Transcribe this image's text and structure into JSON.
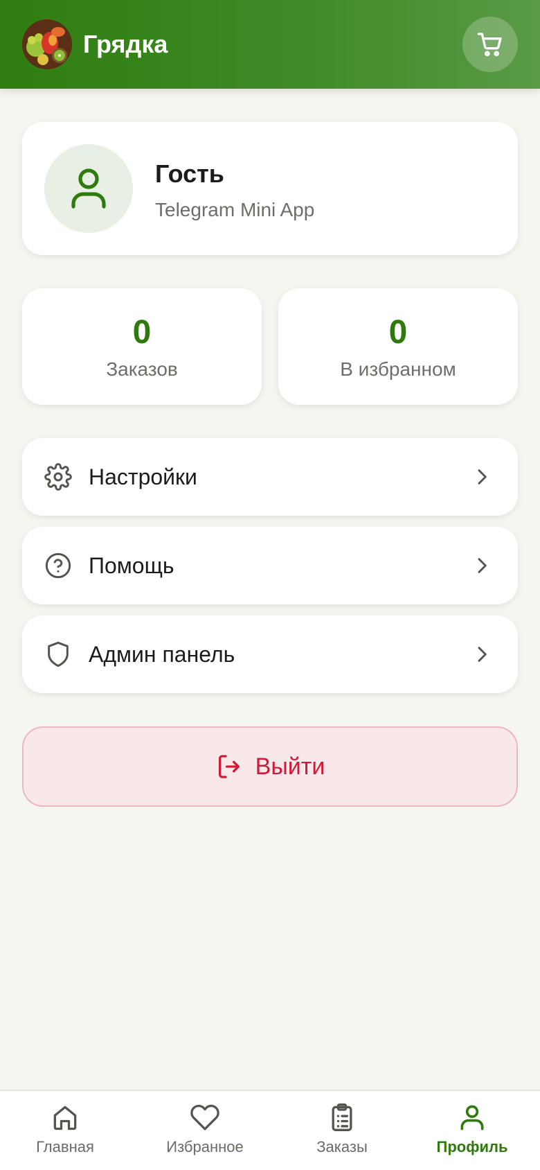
{
  "header": {
    "title": "Грядка",
    "logo_icon": "fruit-logo",
    "cart_icon": "cart-icon"
  },
  "profile": {
    "name": "Гость",
    "subtitle": "Telegram Mini App",
    "avatar_icon": "user-icon"
  },
  "stats": [
    {
      "value": "0",
      "label": "Заказов"
    },
    {
      "value": "0",
      "label": "В избранном"
    }
  ],
  "menu": [
    {
      "label": "Настройки",
      "icon": "gear-icon"
    },
    {
      "label": "Помощь",
      "icon": "help-circle-icon"
    },
    {
      "label": "Админ панель",
      "icon": "shield-icon"
    }
  ],
  "logout": {
    "label": "Выйти",
    "icon": "logout-icon"
  },
  "nav": [
    {
      "label": "Главная",
      "icon": "home-icon",
      "active": false
    },
    {
      "label": "Избранное",
      "icon": "heart-icon",
      "active": false
    },
    {
      "label": "Заказы",
      "icon": "clipboard-icon",
      "active": false
    },
    {
      "label": "Профиль",
      "icon": "user-icon",
      "active": true
    }
  ],
  "colors": {
    "brand": "#2f7a0d",
    "header_gradient_start": "#2f7d10",
    "header_gradient_end": "#5a9a45",
    "background": "#f6f6f1",
    "danger": "#d11a3a",
    "danger_bg": "#f8e8ea"
  }
}
